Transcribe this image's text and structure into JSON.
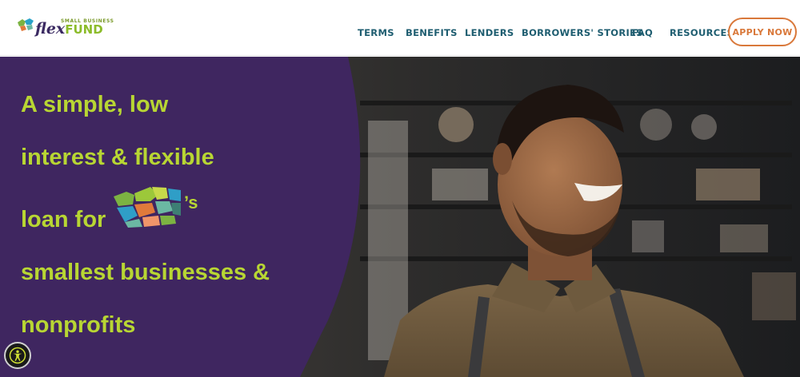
{
  "brand": {
    "small_text": "SMALL BUSINESS",
    "flex": "flex",
    "fund": "FUND"
  },
  "nav": {
    "items": [
      "TERMS",
      "BENEFITS",
      "LENDERS",
      "BORROWERS' STORIES",
      "FAQ",
      "RESOURCES"
    ],
    "apply_label": "APPLY NOW"
  },
  "hero": {
    "lines": [
      "A simple, low",
      "interest & flexible",
      "loan for",
      "smallest businesses &",
      "nonprofits"
    ],
    "possessive": "’s",
    "map_icon": "washington-state-map-icon"
  },
  "accessibility": {
    "icon": "accessibility-icon"
  },
  "colors": {
    "purple": "#3f2660",
    "lime": "#b8d633",
    "nav_teal": "#1e5d70",
    "apply_orange": "#d9783a"
  }
}
